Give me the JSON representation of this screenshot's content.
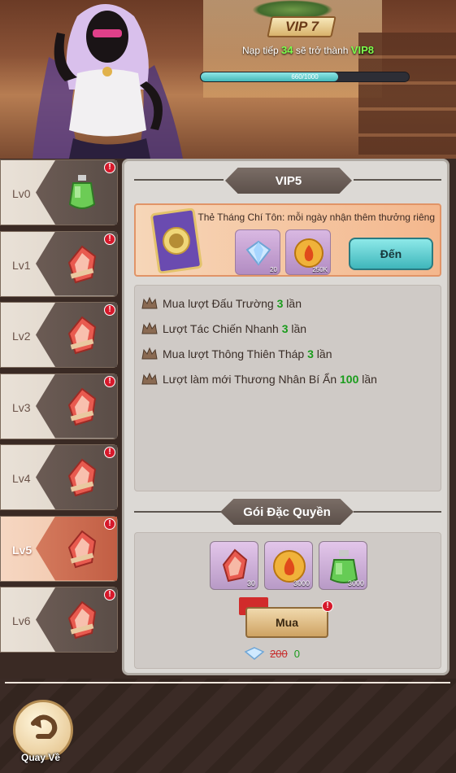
{
  "header": {
    "vip_level": "VIP 7",
    "next_prefix": "Nạp tiếp",
    "next_amount": "34",
    "next_mid": "sẽ trở thành",
    "next_target": "VIP8",
    "progress_text": "660/1000",
    "progress_fraction": 0.66
  },
  "sidebar": {
    "items": [
      {
        "label": "Lv0",
        "icon": "green-potion-icon",
        "badge": "!"
      },
      {
        "label": "Lv1",
        "icon": "red-crystal-icon",
        "badge": "!"
      },
      {
        "label": "Lv2",
        "icon": "red-crystal-icon",
        "badge": "!"
      },
      {
        "label": "Lv3",
        "icon": "red-crystal-icon",
        "badge": "!"
      },
      {
        "label": "Lv4",
        "icon": "red-crystal-icon",
        "badge": "!"
      },
      {
        "label": "Lv5",
        "icon": "red-crystal-icon",
        "badge": "!",
        "active": true
      },
      {
        "label": "Lv6",
        "icon": "red-crystal-icon",
        "badge": "!"
      }
    ]
  },
  "panel": {
    "title": "VIP5",
    "card": {
      "description": "Thẻ Tháng Chí Tôn: mỗi ngày nhận thêm thưởng riêng",
      "rewards": [
        {
          "icon": "diamond-icon",
          "count": "20"
        },
        {
          "icon": "gold-coin-icon",
          "count": "250K"
        }
      ],
      "go_button": "Đến"
    },
    "perks": [
      {
        "text": "Mua lượt Đấu Trường",
        "value": "3",
        "unit": "lần"
      },
      {
        "text": "Lượt Tác Chiến Nhanh",
        "value": "3",
        "unit": "lần"
      },
      {
        "text": "Mua lượt Thông Thiên Tháp",
        "value": "3",
        "unit": "lần"
      },
      {
        "text": "Lượt làm mới Thương Nhân Bí Ẩn",
        "value": "100",
        "unit": "lần"
      }
    ],
    "bundle_title": "Gói Đặc Quyền",
    "bundle_items": [
      {
        "icon": "red-crystal-icon",
        "count": "30"
      },
      {
        "icon": "gold-coin-icon",
        "count": "3000"
      },
      {
        "icon": "green-potion-icon",
        "count": "3000"
      }
    ],
    "buy_button": "Mua",
    "buy_badge": "!",
    "price_old": "200",
    "price_new": "0"
  },
  "footer": {
    "back_label": "Quay Về"
  }
}
